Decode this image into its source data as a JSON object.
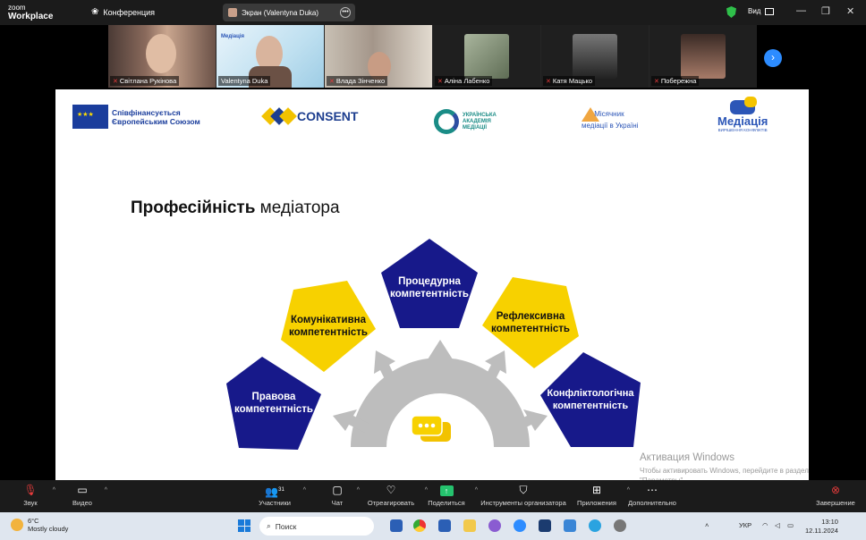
{
  "window": {
    "app_brand_top": "zoom",
    "app_brand_bottom": "Workplace",
    "meeting_label": "Конференция",
    "screen_share_label": "Экран (Valentyna Duka)",
    "view_label": "Вид"
  },
  "gallery": {
    "participants": [
      {
        "name": "Світлана Рукінова",
        "muted": true
      },
      {
        "name": "Valentyna Duka",
        "muted": false
      },
      {
        "name": "Влада Зінченко",
        "muted": true
      },
      {
        "name": "Аліна Лабенко",
        "muted": true
      },
      {
        "name": "Катя Мацько",
        "muted": true
      },
      {
        "name": "Побережна",
        "muted": true
      }
    ],
    "thumb_caption": "Медіація"
  },
  "slide": {
    "eu_logo_text": "Співфінансується Європейським Союзом",
    "consent_logo_text": "CONSENT",
    "uam_logo_text": "УКРАЇНСЬКА АКАДЕМІЯ МЕДІАЦІЇ",
    "tyzhden_logo_text": "Місячник медіації в Україні",
    "mediatsiia_logo_text": "Медіація",
    "mediatsiia_logo_sub": "ВИРІШЕННЯ КОНФЛІКТІВ",
    "title_bold": "Професійність",
    "title_rest": " медіатора",
    "competencies": [
      {
        "line1": "Процедурна",
        "line2": "компетентність",
        "color": "navy"
      },
      {
        "line1": "Рефлексивна",
        "line2": "компетентність",
        "color": "yellow"
      },
      {
        "line1": "Комунікативна",
        "line2": "компетентність",
        "color": "yellow"
      },
      {
        "line1": "Конфліктологічна",
        "line2": "компетентність",
        "color": "navy"
      },
      {
        "line1": "Правова",
        "line2": "компетентність",
        "color": "navy"
      }
    ]
  },
  "activation": {
    "heading": "Активация Windows",
    "text": "Чтобы активировать Windows, перейдите в раздел \"Параметры\"."
  },
  "toolbar": {
    "audio": "Звук",
    "video": "Видео",
    "participants": "Участники",
    "participants_count": "31",
    "chat": "Чат",
    "react": "Отреагировать",
    "share": "Поделиться",
    "host_tools": "Инструменты организатора",
    "apps": "Приложения",
    "more": "Дополнительно",
    "end": "Завершение"
  },
  "taskbar": {
    "temperature": "6°C",
    "weather": "Mostly cloudy",
    "search_placeholder": "Поиск",
    "language": "УКР",
    "time": "13:10",
    "date": "12.11.2024"
  },
  "colors": {
    "navy": "#17198a",
    "yellow": "#f7d100",
    "gear": "#bdbdbd",
    "zoom_blue": "#2d8cff",
    "active_green": "#25c26e"
  }
}
